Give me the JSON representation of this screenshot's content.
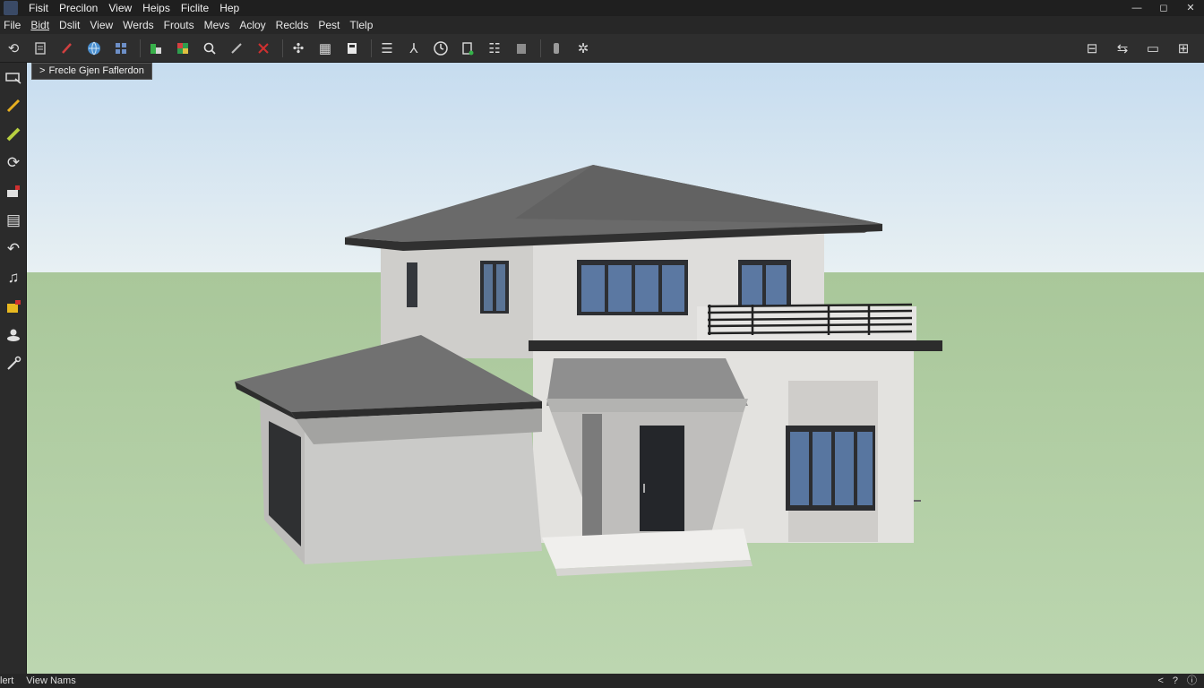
{
  "titlebar": {
    "menu": [
      "Fisit",
      "Precilon",
      "View",
      "Heips",
      "Ficlite",
      "Hep"
    ],
    "controls": [
      "—",
      "◻",
      "✕"
    ]
  },
  "menubar": {
    "items": [
      "File",
      "Bidt",
      "Dslit",
      "View",
      "Werds",
      "Frouts",
      "Mevs",
      "Acloy",
      "Reclds",
      "Pest",
      "Tlelp"
    ]
  },
  "toolbar": {
    "icons": [
      "orbit-icon",
      "document-icon",
      "pencil-icon",
      "globe-icon",
      "components-icon",
      "paint-icon",
      "materials-icon",
      "search-icon",
      "line-icon",
      "delete-icon",
      "move-icon",
      "section-icon",
      "box-icon",
      "text-icon",
      "dimension-icon",
      "clock-icon",
      "layers-icon",
      "list-icon",
      "folder-icon",
      "bottle-icon",
      "settings-icon"
    ],
    "right_icons": [
      "panel-left-icon",
      "panel-right-icon",
      "window-icon",
      "grid-icon"
    ]
  },
  "left_toolbar": {
    "icons": [
      "select-icon",
      "pencil-icon",
      "eraser-icon",
      "rotate-icon",
      "block-icon",
      "document-icon",
      "arc-icon",
      "music-icon",
      "house-icon",
      "person-icon",
      "tape-icon"
    ]
  },
  "scene_tab": {
    "chevron": ">",
    "label": "Frecle Gjen Faflerdon"
  },
  "statusbar": {
    "left_label": "lert",
    "view_label": "View Nams",
    "right_icons": [
      "<",
      "?",
      "ⓘ"
    ]
  }
}
